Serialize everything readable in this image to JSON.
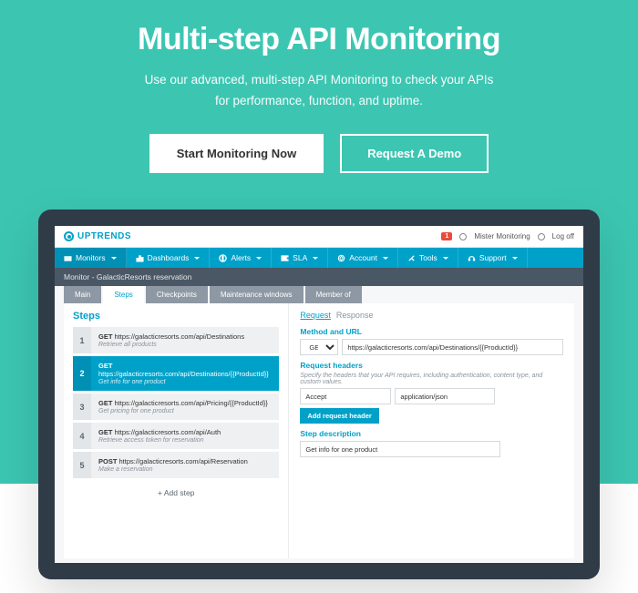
{
  "hero": {
    "title": "Multi-step API Monitoring",
    "subtitle_l1": "Use our advanced, multi-step API Monitoring to check your APIs",
    "subtitle_l2": "for performance, function, and uptime.",
    "cta_primary": "Start Monitoring Now",
    "cta_secondary": "Request A Demo"
  },
  "app": {
    "brand": "UPTRENDS",
    "badge": "1",
    "user": "Mister Monitoring",
    "logoff": "Log off",
    "nav": [
      {
        "icon": "monitors",
        "label": "Monitors"
      },
      {
        "icon": "dashboards",
        "label": "Dashboards"
      },
      {
        "icon": "alerts",
        "label": "Alerts"
      },
      {
        "icon": "sla",
        "label": "SLA"
      },
      {
        "icon": "account",
        "label": "Account"
      },
      {
        "icon": "tools",
        "label": "Tools"
      },
      {
        "icon": "support",
        "label": "Support"
      }
    ],
    "breadcrumb": "Monitor - GalacticResorts reservation",
    "tabs": [
      "Main",
      "Steps",
      "Checkpoints",
      "Maintenance windows",
      "Member of"
    ],
    "active_tab": 1,
    "steps_title": "Steps",
    "steps": [
      {
        "n": "1",
        "method": "GET",
        "url": "https://galacticresorts.com/api/Destinations",
        "desc": "Retrieve all products"
      },
      {
        "n": "2",
        "method": "GET",
        "url": "https://galacticresorts.com/api/Destinations/{{ProductId}}",
        "desc": "Get info for one product"
      },
      {
        "n": "3",
        "method": "GET",
        "url": "https://galacticresorts.com/api/Pricing/{{ProductId}}",
        "desc": "Get pricing for one product"
      },
      {
        "n": "4",
        "method": "GET",
        "url": "https://galacticresorts.com/api/Auth",
        "desc": "Retrieve access token for reservation"
      },
      {
        "n": "5",
        "method": "POST",
        "url": "https://galacticresorts.com/api/Reservation",
        "desc": "Make a reservation"
      }
    ],
    "active_step": 1,
    "add_step": "+ Add step",
    "detail": {
      "rr_tabs": [
        "Request",
        "Response"
      ],
      "rr_active": 0,
      "method_url_label": "Method and URL",
      "method": "GET",
      "url": "https://galacticresorts.com/api/Destinations/{{ProductId}}",
      "headers_label": "Request headers",
      "headers_hint": "Specify the headers that your API requires, including authentication, content type, and custom values.",
      "header_key": "Accept",
      "header_val": "application/json",
      "add_header": "Add request header",
      "desc_label": "Step description",
      "desc_value": "Get info for one product"
    }
  }
}
